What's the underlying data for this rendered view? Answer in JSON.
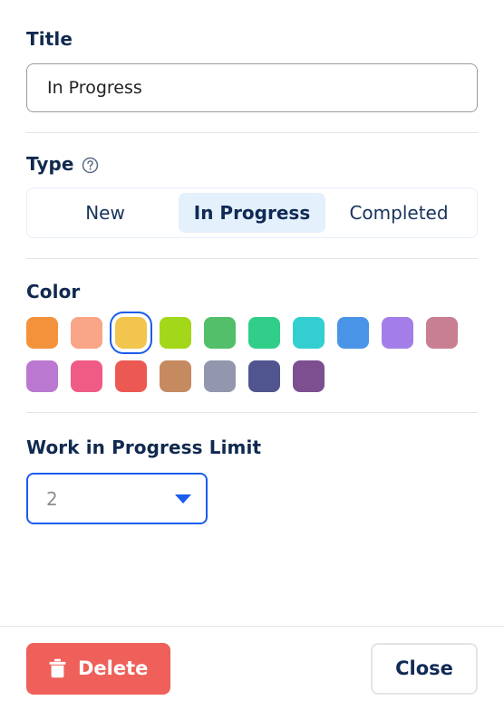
{
  "accent": {
    "primary_blue": "#1a5ded",
    "heading_navy": "#10294e",
    "danger_red": "#ee6059",
    "divider": "#e2e4e8",
    "segment_active_bg": "#e4f0fb"
  },
  "title_section": {
    "label": "Title",
    "value": "In Progress",
    "placeholder": "Title"
  },
  "type_section": {
    "label": "Type",
    "help_icon": "help-circle-icon",
    "options": [
      {
        "label": "New",
        "selected": false
      },
      {
        "label": "In Progress",
        "selected": true
      },
      {
        "label": "Completed",
        "selected": false
      }
    ]
  },
  "color_section": {
    "label": "Color",
    "selected_index": 2,
    "swatches": [
      {
        "hex": "#f4923c",
        "name": "orange"
      },
      {
        "hex": "#f9a587",
        "name": "salmon"
      },
      {
        "hex": "#f1c54e",
        "name": "yellow"
      },
      {
        "hex": "#a2d71a",
        "name": "lime"
      },
      {
        "hex": "#53bf6a",
        "name": "green"
      },
      {
        "hex": "#31ce8a",
        "name": "emerald"
      },
      {
        "hex": "#33cfd0",
        "name": "teal"
      },
      {
        "hex": "#4a94e8",
        "name": "blue"
      },
      {
        "hex": "#a47ee8",
        "name": "purple"
      },
      {
        "hex": "#c97f92",
        "name": "dusty-rose"
      },
      {
        "hex": "#ba78d0",
        "name": "orchid"
      },
      {
        "hex": "#ef5b85",
        "name": "pink"
      },
      {
        "hex": "#ec5952",
        "name": "red"
      },
      {
        "hex": "#c68a61",
        "name": "tan"
      },
      {
        "hex": "#9297ae",
        "name": "slate-gray"
      },
      {
        "hex": "#51558f",
        "name": "indigo"
      },
      {
        "hex": "#7d4f91",
        "name": "plum"
      }
    ]
  },
  "wip_section": {
    "label": "Work in Progress Limit",
    "value": "2",
    "caret_icon": "chevron-down-icon"
  },
  "footer": {
    "delete_label": "Delete",
    "delete_icon": "trash-icon",
    "close_label": "Close"
  }
}
